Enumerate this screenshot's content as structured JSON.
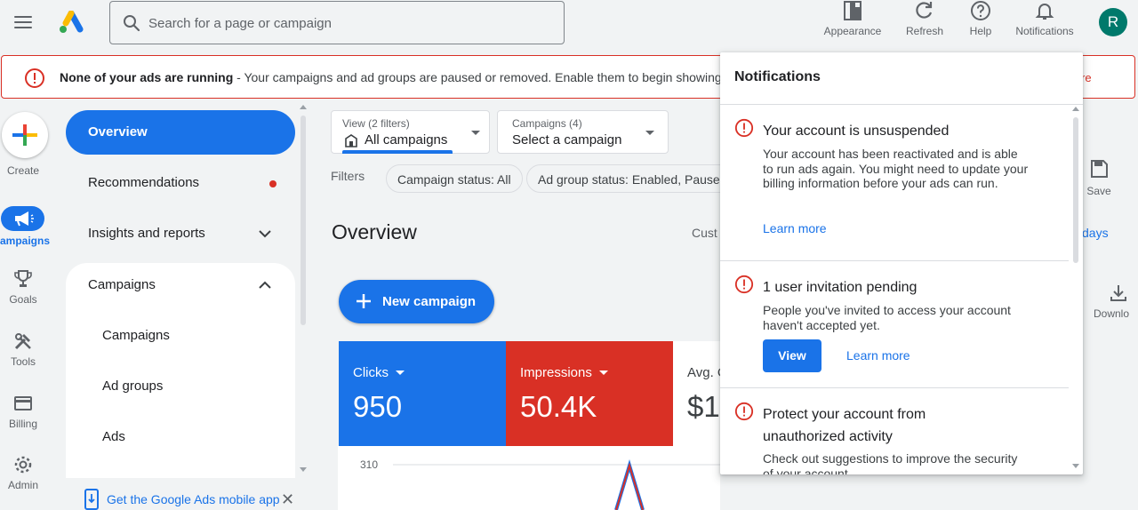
{
  "header": {
    "search_placeholder": "Search for a page or campaign",
    "actions": [
      {
        "label": "Appearance",
        "icon": "appearance-icon"
      },
      {
        "label": "Refresh",
        "icon": "refresh-icon"
      },
      {
        "label": "Help",
        "icon": "help-icon"
      },
      {
        "label": "Notifications",
        "icon": "bell-icon"
      }
    ],
    "avatar_letter": "R",
    "avatar_color": "#00796b"
  },
  "alert": {
    "title": "None of your ads are running",
    "message": " - Your campaigns and ad groups are paused or removed. Enable them to begin showing your ads",
    "trailing": "re"
  },
  "rail": {
    "create": "Create",
    "campaigns": "ampaigns",
    "goals": "Goals",
    "tools": "Tools",
    "billing": "Billing",
    "admin": "Admin"
  },
  "nav": {
    "overview": "Overview",
    "recommendations": "Recommendations",
    "insights": "Insights and reports",
    "campaigns_section": "Campaigns",
    "sub_items": [
      "Campaigns",
      "Ad groups",
      "Ads"
    ]
  },
  "mobile_app": "Get the Google Ads mobile app",
  "view_dropdown": {
    "label": "View (2 filters)",
    "value": "All campaigns"
  },
  "campaign_dropdown": {
    "label": "Campaigns (4)",
    "value": "Select a campaign"
  },
  "filters": {
    "label": "Filters",
    "chips": [
      "Campaign status: All",
      "Ad group status: Enabled, Paused"
    ]
  },
  "overview_title": "Overview",
  "cust_text": "Cust",
  "days_link": "days",
  "save_label": "Save",
  "download_label": "Downlo",
  "new_campaign": "New campaign",
  "metrics": [
    {
      "label": "Clicks",
      "value": "950",
      "color": "#1a73e8"
    },
    {
      "label": "Impressions",
      "value": "50.4K",
      "color": "#d93025"
    },
    {
      "label": "Avg. C",
      "value": "$1.",
      "color": "#ffffff"
    }
  ],
  "chart_data": {
    "type": "line",
    "tick_labels": [
      "310"
    ],
    "series": [
      {
        "color": "#1a73e8"
      },
      {
        "color": "#d93025"
      }
    ]
  },
  "notifications": {
    "title": "Notifications",
    "items": [
      {
        "title": "Your account is unsuspended",
        "body": "Your account has been reactivated and is able to run ads again. You might need to update your billing information before your ads can run.",
        "link": "Learn more"
      },
      {
        "title": "1 user invitation pending",
        "body": "People you've invited to access your account haven't accepted yet.",
        "button": "View",
        "link": "Learn more"
      },
      {
        "title": "Protect your account from unauthorized activity",
        "body": "Check out suggestions to improve the security of your account."
      }
    ]
  },
  "colors": {
    "accent": "#1a73e8",
    "error": "#d93025",
    "background": "#f1f3f4"
  }
}
